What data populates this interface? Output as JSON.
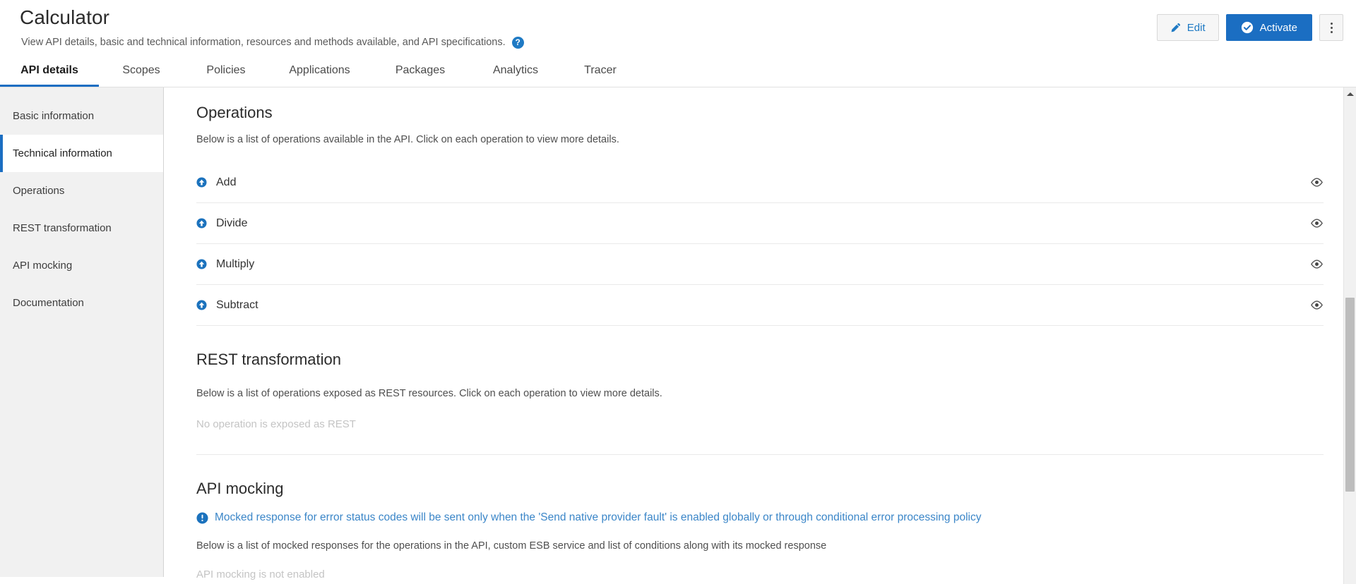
{
  "header": {
    "title": "Calculator",
    "subtitle": "View API details, basic and technical information, resources and methods available, and API specifications.",
    "help_icon": "help-circle-icon",
    "actions": {
      "edit_label": "Edit",
      "edit_icon": "pencil-icon",
      "activate_label": "Activate",
      "activate_icon": "check-circle-icon",
      "more_icon": "kebab-menu-icon"
    }
  },
  "tabs": [
    {
      "label": "API details",
      "active": true
    },
    {
      "label": "Scopes",
      "active": false
    },
    {
      "label": "Policies",
      "active": false
    },
    {
      "label": "Applications",
      "active": false
    },
    {
      "label": "Packages",
      "active": false
    },
    {
      "label": "Analytics",
      "active": false
    },
    {
      "label": "Tracer",
      "active": false
    }
  ],
  "sidebar": {
    "items": [
      {
        "label": "Basic information",
        "active": false
      },
      {
        "label": "Technical information",
        "active": true
      },
      {
        "label": "Operations",
        "active": false
      },
      {
        "label": "REST transformation",
        "active": false
      },
      {
        "label": "API mocking",
        "active": false
      },
      {
        "label": "Documentation",
        "active": false
      }
    ]
  },
  "content": {
    "operations": {
      "title": "Operations",
      "description": "Below is a list of operations available in the API. Click on each operation to view more details.",
      "row_icon": "arrow-up-circle-icon",
      "row_action_icon": "eye-icon",
      "items": [
        {
          "name": "Add"
        },
        {
          "name": "Divide"
        },
        {
          "name": "Multiply"
        },
        {
          "name": "Subtract"
        }
      ]
    },
    "rest_transformation": {
      "title": "REST transformation",
      "description": "Below is a list of operations exposed as REST resources. Click on each operation to view more details.",
      "empty_note": "No operation is exposed as REST"
    },
    "api_mocking": {
      "title": "API mocking",
      "info_icon": "info-circle-icon",
      "info_text": "Mocked response for error status codes will be sent only when the 'Send native provider fault' is enabled globally or through conditional error processing policy",
      "description": "Below is a list of mocked responses for the operations in the API, custom ESB service and list of conditions along with its mocked response",
      "empty_note": "API mocking is not enabled"
    }
  },
  "scrollbar": {
    "up_arrow_icon": "scroll-up-arrow-icon",
    "thumb": "scrollbar-thumb"
  },
  "colors": {
    "accent": "#1b6ec2",
    "link": "#3b86c8",
    "muted": "#c4c4c4",
    "sidebar_bg": "#f1f1f1"
  }
}
